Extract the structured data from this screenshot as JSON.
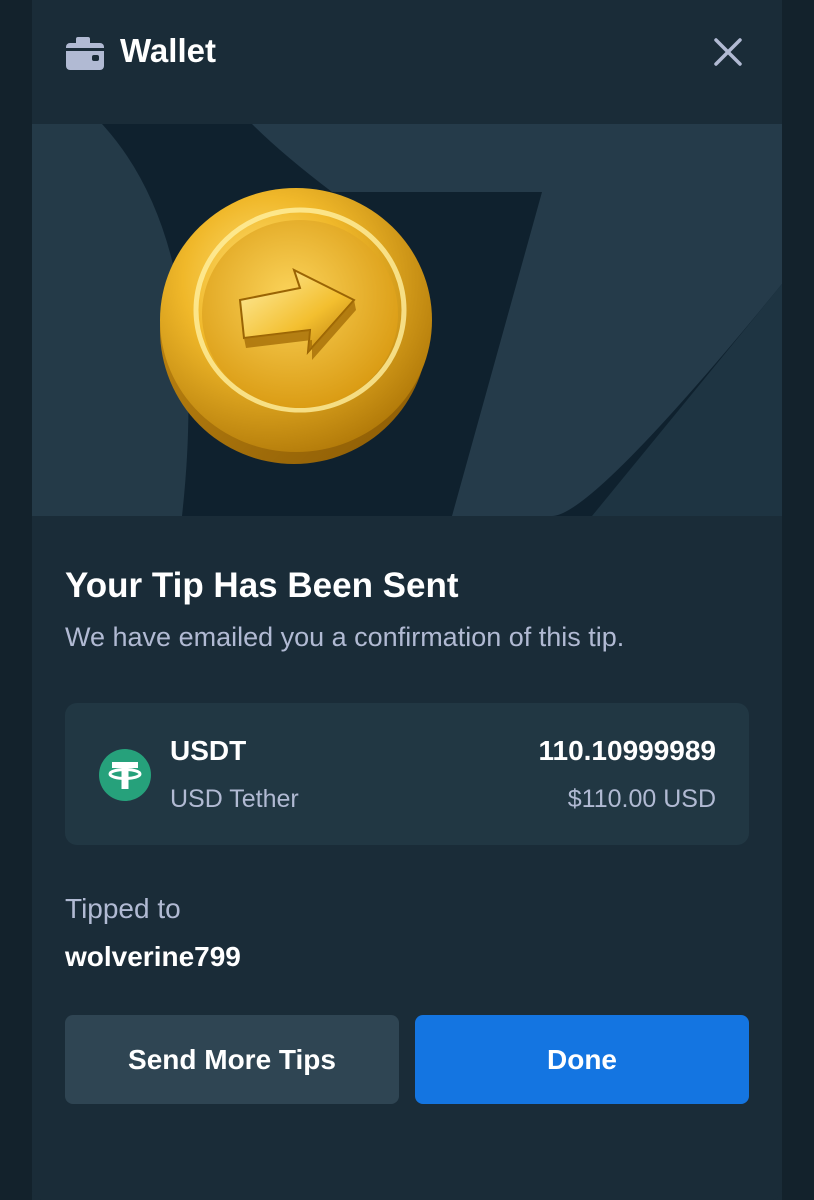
{
  "header": {
    "title": "Wallet",
    "icon": "wallet-icon",
    "close_icon": "close-icon"
  },
  "banner": {
    "image": "gold-coin-arrow-illustration"
  },
  "content": {
    "title": "Your Tip Has Been Sent",
    "subtitle": "We have emailed you a confirmation of this tip."
  },
  "token": {
    "icon": "tether-icon",
    "symbol": "USDT",
    "name": "USD Tether",
    "amount": "110.10999989",
    "usd_value": "$110.00 USD",
    "icon_color": "#26a17b"
  },
  "tipped": {
    "label": "Tipped to",
    "username": "wolverine799"
  },
  "buttons": {
    "secondary_label": "Send More Tips",
    "primary_label": "Done"
  },
  "colors": {
    "background": "#1a2c38",
    "card": "#213743",
    "primary_button": "#1475e1",
    "secondary_button": "#2f4553",
    "muted_text": "#b1bad3"
  }
}
